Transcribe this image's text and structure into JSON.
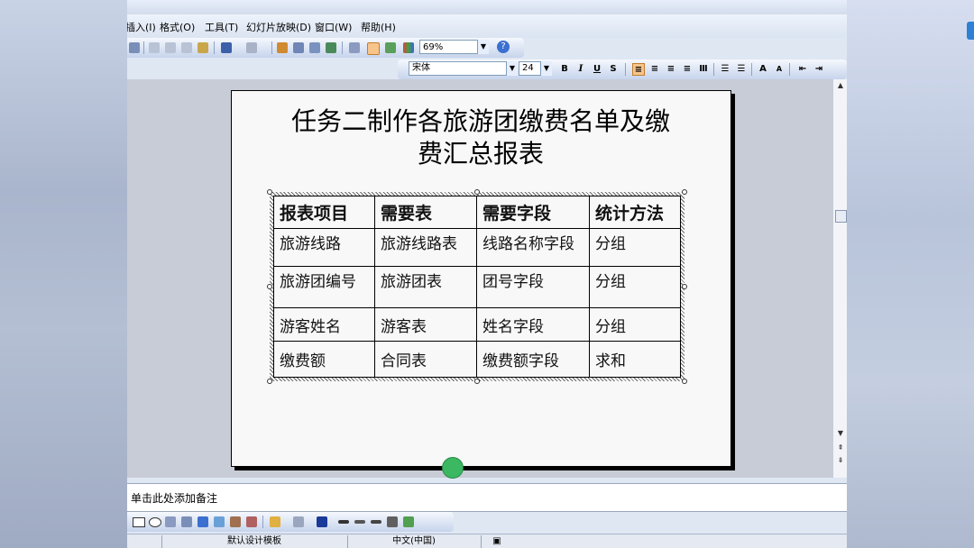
{
  "menu": {
    "items": [
      "插入(I)",
      "格式(O)",
      "工具(T)",
      "幻灯片放映(D)",
      "窗口(W)",
      "帮助(H)"
    ]
  },
  "toolbar": {
    "zoom": "69%",
    "help_icon": "?"
  },
  "format_bar": {
    "font_name": "宋体",
    "font_size": "24",
    "bold": "B",
    "italic": "I",
    "underline": "U",
    "shadow": "S",
    "increase_font": "A",
    "decrease_font": "A"
  },
  "slide": {
    "title_line1": "任务二制作各旅游团缴费名单及缴",
    "title_line2": "费汇总报表",
    "table": {
      "headers": [
        "报表项目",
        "需要表",
        "需要字段",
        "统计方法"
      ],
      "rows": [
        [
          "旅游线路",
          "旅游线路表",
          "线路名称字段",
          "分组"
        ],
        [
          "旅游团编号",
          "旅游团表",
          "团号字段",
          "分组"
        ],
        [
          "游客姓名",
          "游客表",
          "姓名字段",
          "分组"
        ],
        [
          "缴费额",
          "合同表",
          "缴费额字段",
          "求和"
        ]
      ]
    }
  },
  "notes": {
    "placeholder": "单击此处添加备注"
  },
  "status": {
    "template": "默认设计模板",
    "language": "中文(中国)"
  },
  "colors": {
    "accent_orange": "#f7c58a",
    "toolbar_blue": "#c6d4ec",
    "green_marker": "#3cb862"
  }
}
